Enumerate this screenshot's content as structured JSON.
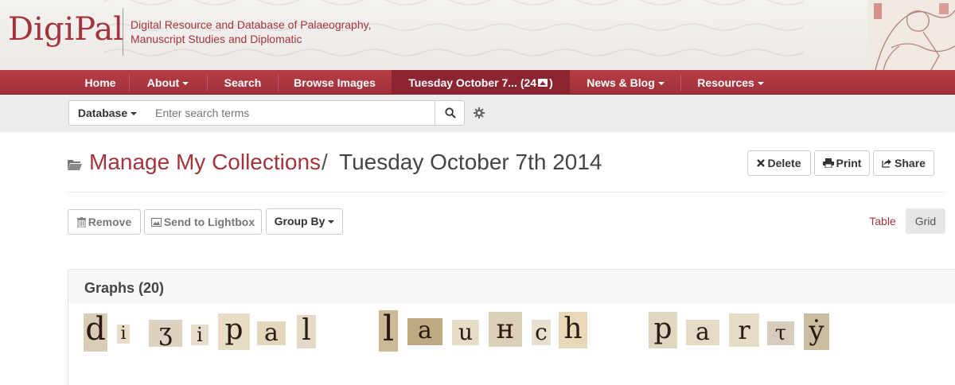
{
  "header": {
    "logo": "DigiPal",
    "tagline_line1": "Digital Resource and Database of Palaeography,",
    "tagline_line2": "Manuscript Studies and Diplomatic"
  },
  "nav": {
    "home": "Home",
    "about": "About",
    "search": "Search",
    "browse_images": "Browse Images",
    "collection": "Tuesday October 7... (24",
    "collection_close": ")",
    "news_blog": "News & Blog",
    "resources": "Resources"
  },
  "search": {
    "scope": "Database",
    "placeholder": "Enter search terms"
  },
  "page": {
    "breadcrumb_link": "Manage My Collections",
    "separator": "/",
    "collection_title": "Tuesday October 7th 2014"
  },
  "actions": {
    "delete": "Delete",
    "print": "Print",
    "share": "Share"
  },
  "toolbar": {
    "remove": "Remove",
    "send_to_lightbox": "Send to Lightbox",
    "group_by": "Group By",
    "view_table": "Table",
    "view_grid": "Grid"
  },
  "graphs": {
    "heading": "Graphs (20)",
    "letters": [
      "d",
      "i",
      "ʒ",
      "i",
      "p",
      "a",
      "l",
      "l",
      "a",
      "u",
      "н",
      "c",
      "h",
      "p",
      "a",
      "r",
      "τ",
      "ẏ"
    ]
  },
  "colors": {
    "brand": "#a2343c",
    "nav_active": "#8c2530"
  }
}
